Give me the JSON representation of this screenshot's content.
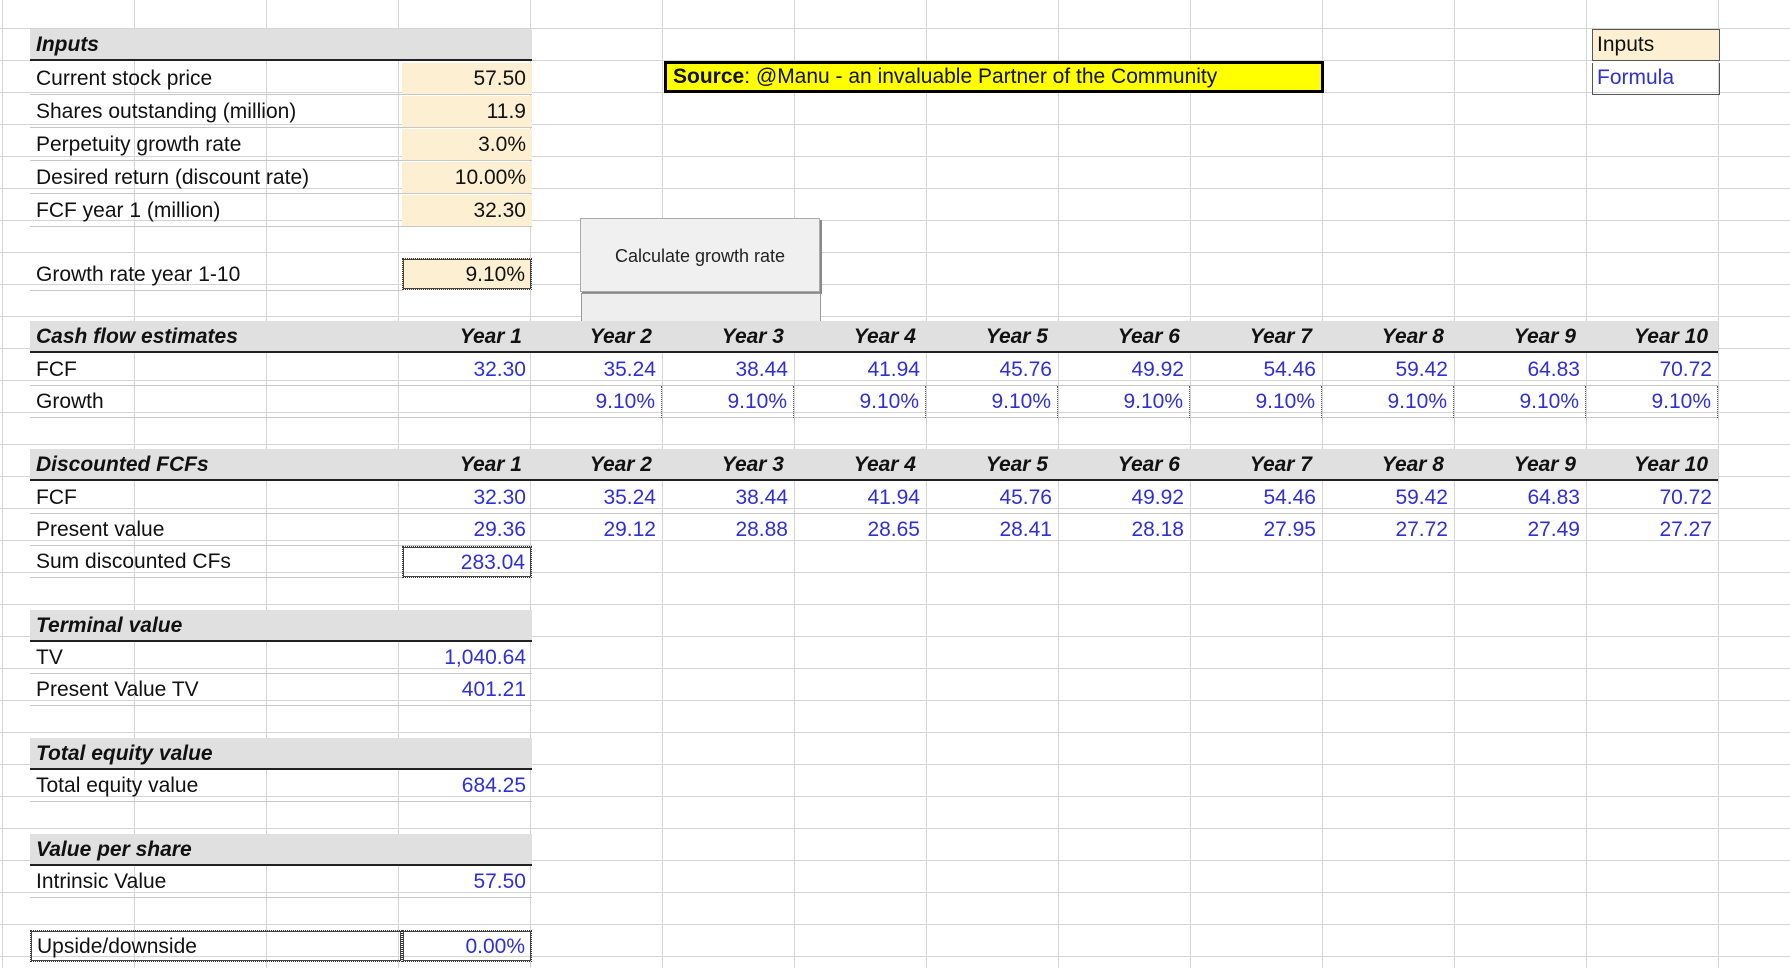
{
  "inputs": {
    "title": "Inputs",
    "rows": [
      {
        "label": "Current stock price",
        "value": "57.50"
      },
      {
        "label": "Shares outstanding (million)",
        "value": "11.9"
      },
      {
        "label": "Perpetuity growth rate",
        "value": "3.0%"
      },
      {
        "label": "Desired return (discount rate)",
        "value": "10.00%"
      },
      {
        "label": "FCF year 1 (million)",
        "value": "32.30"
      }
    ],
    "growth_label": "Growth rate year 1-10",
    "growth_value": "9.10%"
  },
  "source": {
    "bold": "Source",
    "text": ": @Manu - an invaluable Partner of the Community"
  },
  "button": {
    "label": "Calculate growth rate"
  },
  "legend": {
    "inputs": "Inputs",
    "formula": "Formula"
  },
  "colors": {
    "input_bg": "#fdf0d2",
    "formula_text": "#2f2fd8",
    "source_bg": "#ffff00",
    "header_bg": "#e0e0e0"
  },
  "years": [
    "Year 1",
    "Year 2",
    "Year 3",
    "Year 4",
    "Year 5",
    "Year 6",
    "Year 7",
    "Year 8",
    "Year 9",
    "Year 10"
  ],
  "cashflow": {
    "title": "Cash flow estimates",
    "fcf_label": "FCF",
    "fcf": [
      "32.30",
      "35.24",
      "38.44",
      "41.94",
      "45.76",
      "49.92",
      "54.46",
      "59.42",
      "64.83",
      "70.72"
    ],
    "growth_label": "Growth",
    "growth": [
      "",
      "9.10%",
      "9.10%",
      "9.10%",
      "9.10%",
      "9.10%",
      "9.10%",
      "9.10%",
      "9.10%",
      "9.10%"
    ]
  },
  "discounted": {
    "title": "Discounted FCFs",
    "fcf_label": "FCF",
    "fcf": [
      "32.30",
      "35.24",
      "38.44",
      "41.94",
      "45.76",
      "49.92",
      "54.46",
      "59.42",
      "64.83",
      "70.72"
    ],
    "pv_label": "Present value",
    "pv": [
      "29.36",
      "29.12",
      "28.88",
      "28.65",
      "28.41",
      "28.18",
      "27.95",
      "27.72",
      "27.49",
      "27.27"
    ],
    "sum_label": "Sum discounted CFs",
    "sum_value": "283.04"
  },
  "terminal": {
    "title": "Terminal value",
    "tv_label": "TV",
    "tv_value": "1,040.64",
    "pv_label": "Present Value TV",
    "pv_value": "401.21"
  },
  "equity": {
    "title": "Total equity value",
    "label": "Total equity value",
    "value": "684.25"
  },
  "per_share": {
    "title": "Value per share",
    "label": "Intrinsic Value",
    "value": "57.50"
  },
  "upside": {
    "label": "Upside/downside",
    "value": "0.00%"
  }
}
